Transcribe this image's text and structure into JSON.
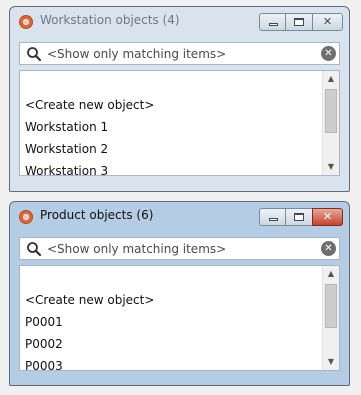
{
  "windows": [
    {
      "title": "Workstation objects (4)",
      "state": "inactive",
      "search_placeholder": "<Show only matching items>",
      "items": [
        "<Create new object>",
        "Workstation 1",
        "Workstation 2",
        "Workstation 3"
      ]
    },
    {
      "title": "Product objects (6)",
      "state": "active",
      "search_placeholder": "<Show only matching items>",
      "items": [
        "<Create new object>",
        "P0001",
        "P0002",
        "P0003"
      ]
    }
  ],
  "controls": {
    "minimize": "minimize-icon",
    "maximize": "maximize-icon",
    "close": "✕"
  },
  "icons": {
    "clear": "✕",
    "scroll_up": "▲",
    "scroll_down": "▼"
  },
  "colors": {
    "active_frame": "#b5cde4",
    "inactive_frame": "#d8e3ee",
    "close_active": "#c6442c"
  }
}
